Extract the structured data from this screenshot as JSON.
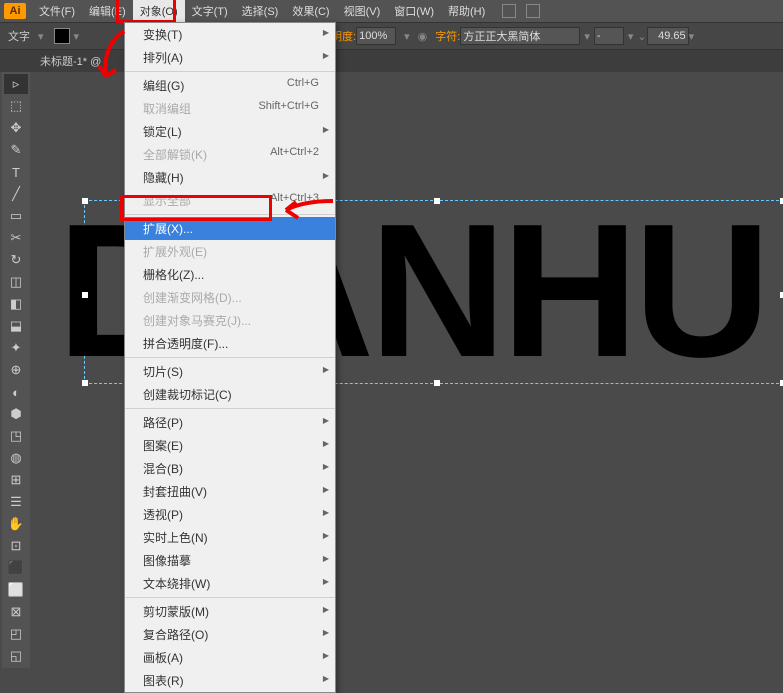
{
  "app_logo": "Ai",
  "menubar": {
    "items": [
      "文件(F)",
      "编辑(E)",
      "对象(O)",
      "文字(T)",
      "选择(S)",
      "效果(C)",
      "视图(V)",
      "窗口(W)",
      "帮助(H)"
    ],
    "active_index": 2
  },
  "optionbar": {
    "tool_label": "文字",
    "opacity_label": "不透明度:",
    "opacity_value": "100%",
    "font_label": "字符:",
    "font_value": "方正正大黑简体",
    "size_value": "49.65"
  },
  "tabs": {
    "doc_title": "未标题-1* @"
  },
  "canvas": {
    "big_text": "DIANHU"
  },
  "dropdown": {
    "groups": [
      [
        {
          "label": "变换(T)",
          "sub": true
        },
        {
          "label": "排列(A)",
          "sub": true
        }
      ],
      [
        {
          "label": "编组(G)",
          "short": "Ctrl+G"
        },
        {
          "label": "取消编组",
          "short": "Shift+Ctrl+G",
          "disabled": true
        },
        {
          "label": "锁定(L)",
          "sub": true
        },
        {
          "label": "全部解锁(K)",
          "short": "Alt+Ctrl+2",
          "disabled": true
        },
        {
          "label": "隐藏(H)",
          "sub": true
        },
        {
          "label": "显示全部",
          "short": "Alt+Ctrl+3",
          "disabled": true
        }
      ],
      [
        {
          "label": "扩展(X)...",
          "hover": true
        },
        {
          "label": "扩展外观(E)",
          "disabled": true
        },
        {
          "label": "栅格化(Z)..."
        },
        {
          "label": "创建渐变网格(D)...",
          "disabled": true
        },
        {
          "label": "创建对象马赛克(J)...",
          "disabled": true
        },
        {
          "label": "拼合透明度(F)..."
        }
      ],
      [
        {
          "label": "切片(S)",
          "sub": true
        },
        {
          "label": "创建裁切标记(C)"
        }
      ],
      [
        {
          "label": "路径(P)",
          "sub": true
        },
        {
          "label": "图案(E)",
          "sub": true
        },
        {
          "label": "混合(B)",
          "sub": true
        },
        {
          "label": "封套扭曲(V)",
          "sub": true
        },
        {
          "label": "透视(P)",
          "sub": true
        },
        {
          "label": "实时上色(N)",
          "sub": true
        },
        {
          "label": "图像描摹",
          "sub": true
        },
        {
          "label": "文本绕排(W)",
          "sub": true
        }
      ],
      [
        {
          "label": "剪切蒙版(M)",
          "sub": true
        },
        {
          "label": "复合路径(O)",
          "sub": true
        },
        {
          "label": "画板(A)",
          "sub": true
        },
        {
          "label": "图表(R)",
          "sub": true
        }
      ]
    ]
  },
  "tools": [
    "▹",
    "⬚",
    "✥",
    "✎",
    "T",
    "╱",
    "▭",
    "✂",
    "↻",
    "◫",
    "◧",
    "⬓",
    "✦",
    "⊕",
    "◐",
    "⬢",
    "◳",
    "◍",
    "⊞",
    "☰",
    "✋",
    "⊡",
    "⬛",
    "⬜",
    "⊠",
    "◰",
    "◱"
  ]
}
